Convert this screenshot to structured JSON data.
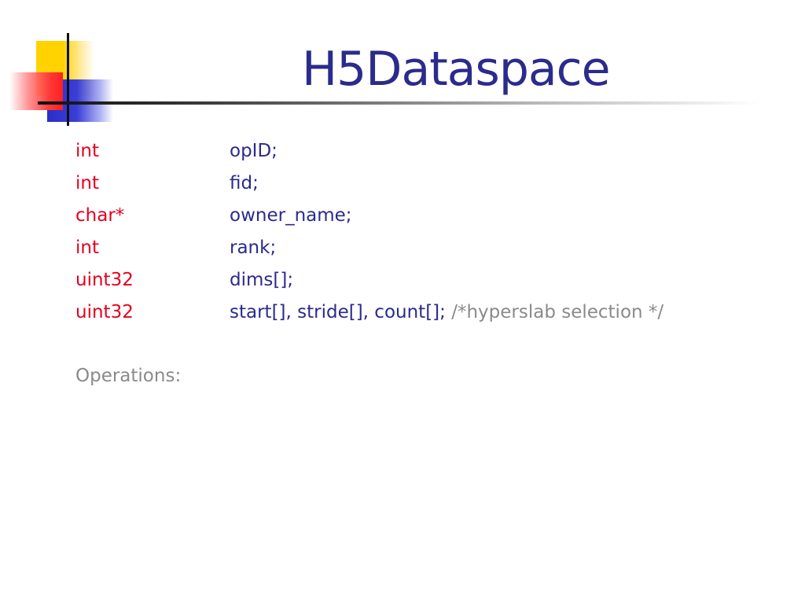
{
  "slide": {
    "title": "H5Dataspace",
    "fields": [
      {
        "type": "int",
        "name": "opID;",
        "comment": ""
      },
      {
        "type": "int",
        "name": "fid;",
        "comment": ""
      },
      {
        "type": "char*",
        "name": "owner_name;",
        "comment": ""
      },
      {
        "type": "int",
        "name": "rank;",
        "comment": ""
      },
      {
        "type": "uint32",
        "name": "dims[];",
        "comment": ""
      },
      {
        "type": "uint32",
        "name": "start[], stride[], count[];",
        "comment": "/*hyperslab selection */"
      }
    ],
    "operations_label": "Operations:"
  },
  "colors": {
    "title": "#2b2b8c",
    "type": "#e6001e",
    "name": "#2b2b8c",
    "comment": "#8a8a8a",
    "logo_yellow": "#ffd200",
    "logo_blue": "#2a2ec8",
    "logo_red": "#ff2020"
  }
}
